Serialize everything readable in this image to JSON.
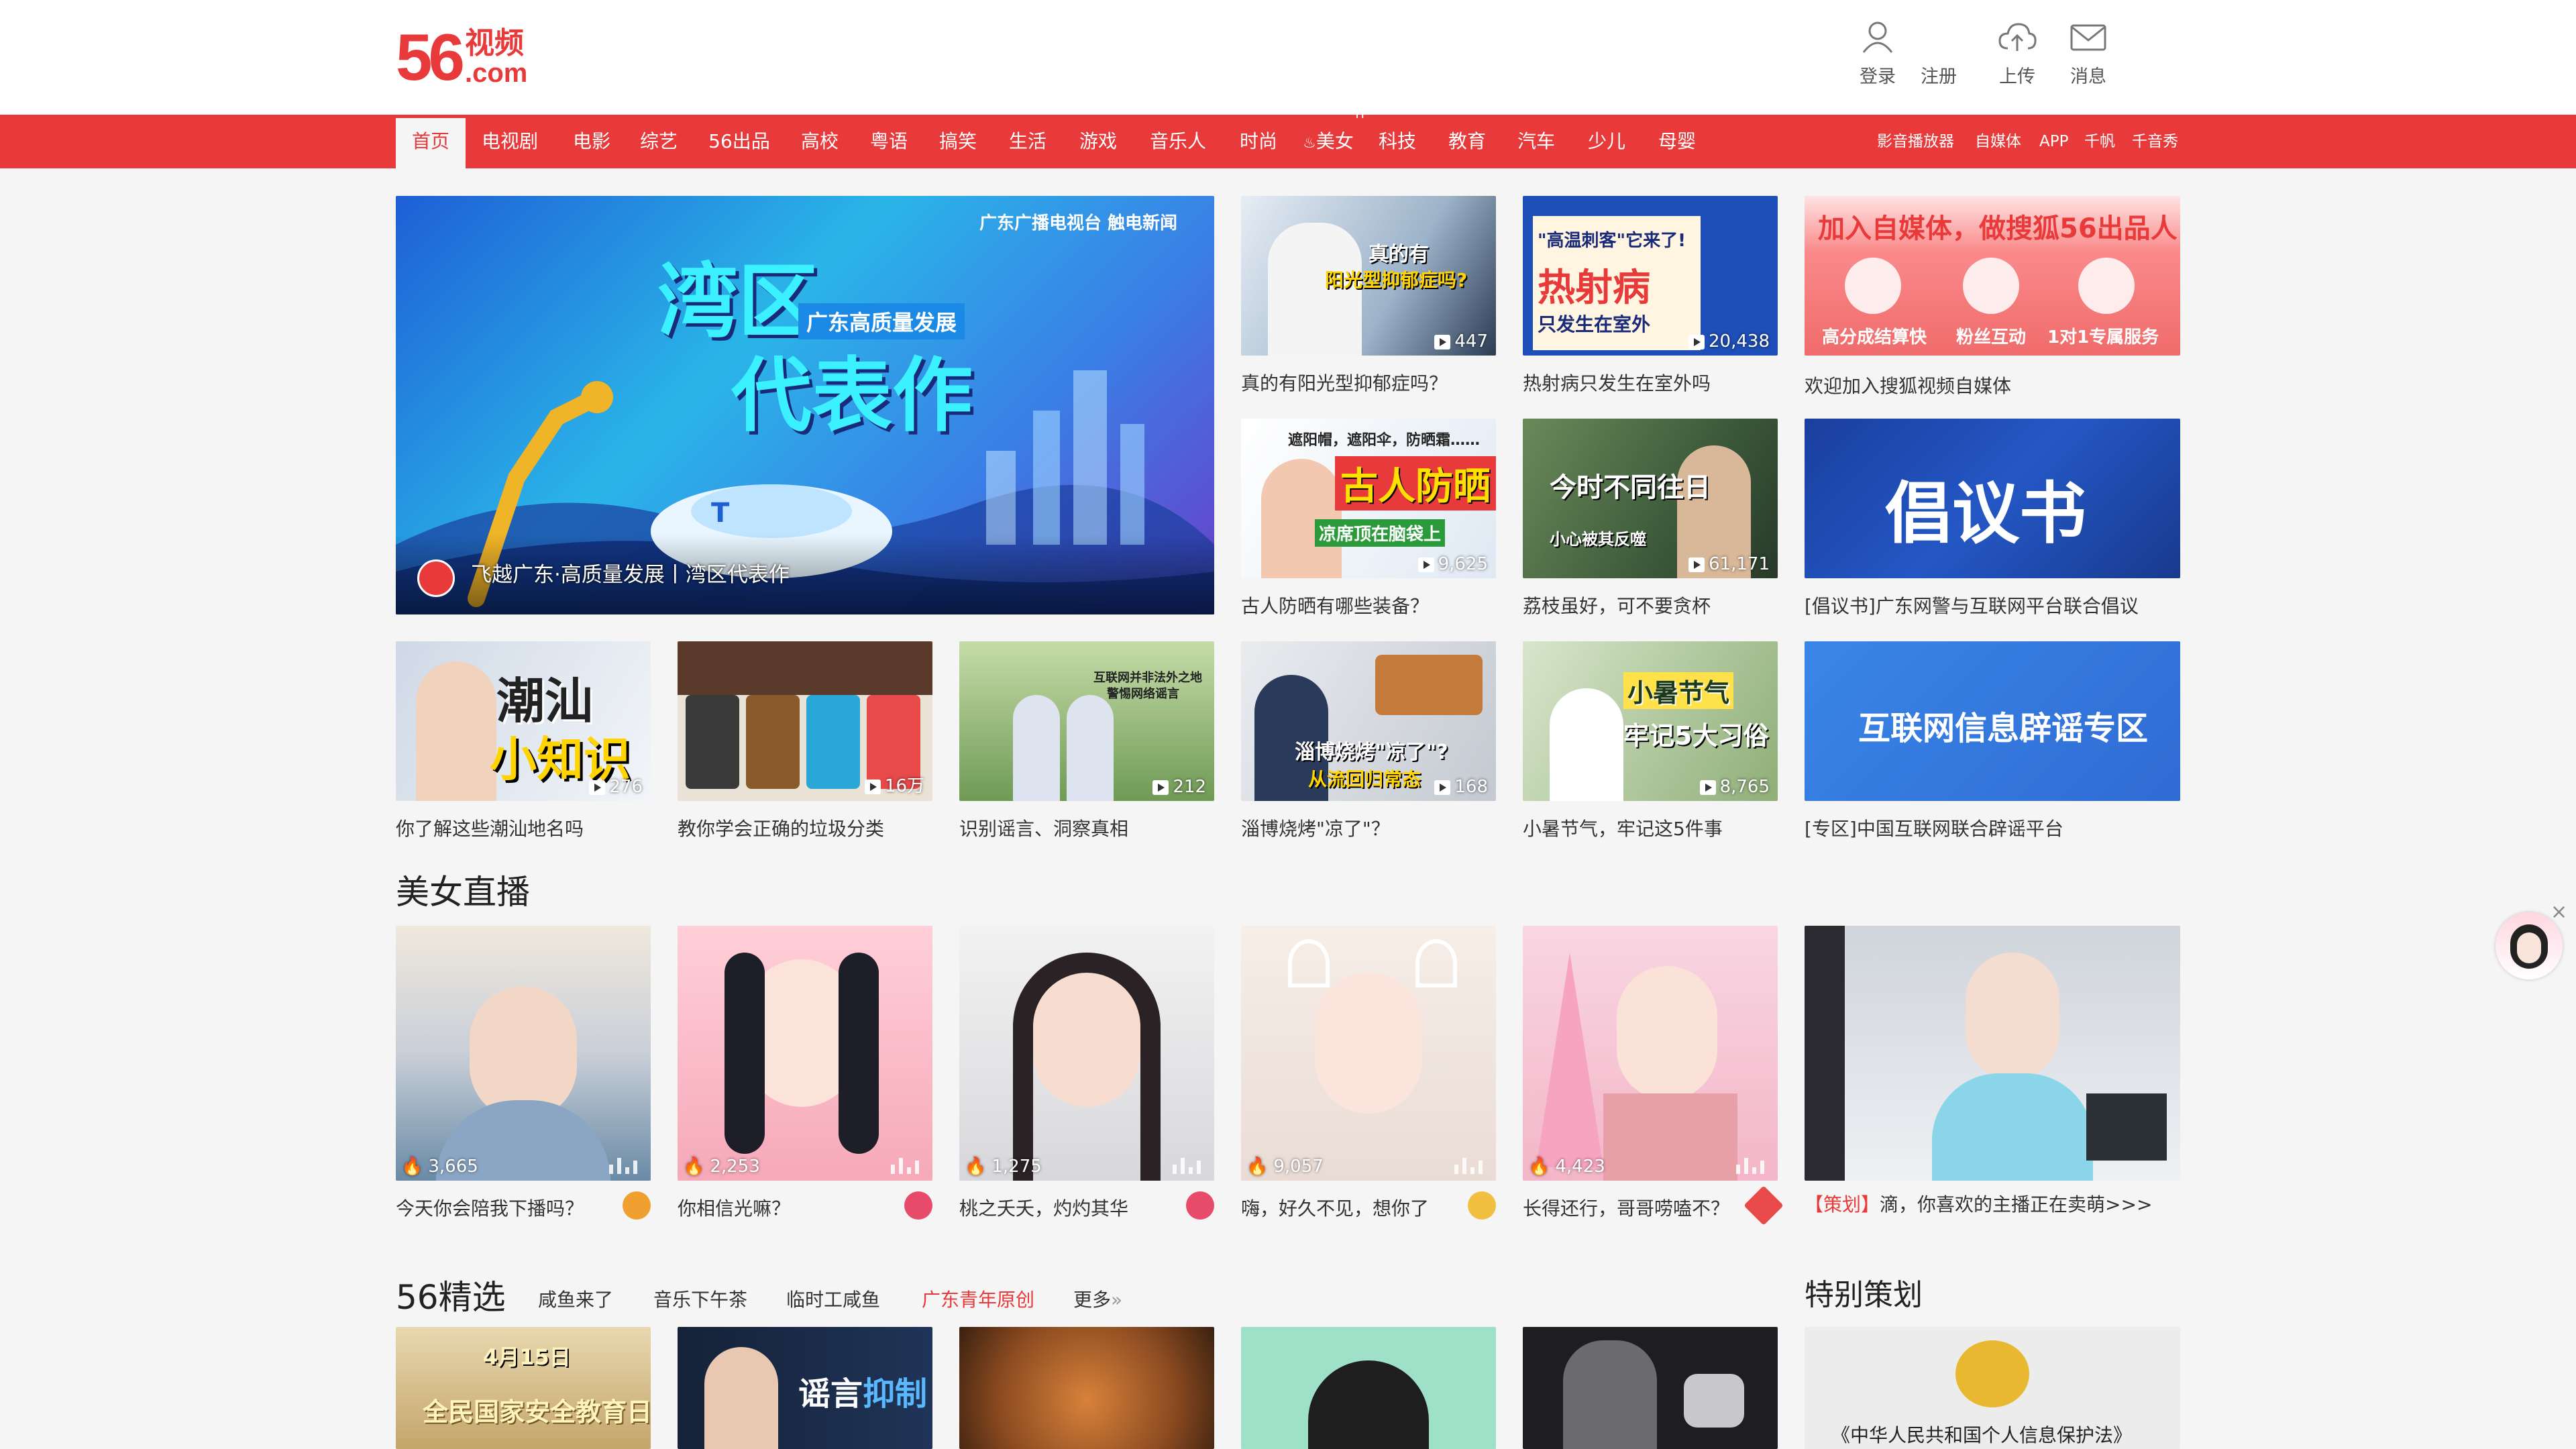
{
  "header": {
    "logo_num": "56",
    "logo_cn": "视频",
    "logo_com": ".com",
    "tools": [
      {
        "label": "登录",
        "icon": "user-icon"
      },
      {
        "label": "注册",
        "icon": ""
      },
      {
        "label": "上传",
        "icon": "upload-cloud-icon"
      },
      {
        "label": "消息",
        "icon": "mail-icon"
      }
    ]
  },
  "nav": {
    "items": [
      "首页",
      "电视剧",
      "电影",
      "综艺",
      "56出品",
      "高校",
      "粤语",
      "搞笑",
      "生活",
      "游戏",
      "音乐人",
      "时尚",
      "美女",
      "科技",
      "教育",
      "汽车",
      "少儿",
      "母婴"
    ],
    "hot_sup": "H",
    "right": [
      "影音播放器",
      "自媒体",
      "APP",
      "千帆",
      "千音秀"
    ]
  },
  "hero": {
    "title_line1": "湾区",
    "title_line2": "代表作",
    "tagline": "广东高质量发展",
    "brands": "广东广播电视台   触电新闻",
    "caption": "飞越广东·高质量发展丨湾区代表作",
    "car_label": "T"
  },
  "grid_top": [
    {
      "overlay1": "真的有",
      "overlay2": "阳光型抑郁症吗?",
      "count": "447",
      "caption": "真的有阳光型抑郁症吗？"
    },
    {
      "overlay1": "\"高温刺客\"它来了!",
      "overlay2": "热射病",
      "overlay3": "只发生在室外",
      "count": "20,438",
      "caption": "热射病只发生在室外吗"
    },
    {
      "overlay1": "遮阳帽，遮阳伞，防晒霜……",
      "overlay2": "古人防晒",
      "overlay3": "凉席顶在脑袋上",
      "count": "9,625",
      "caption": "古人防晒有哪些装备？"
    },
    {
      "overlay1": "今时不同往日",
      "overlay2": "小心被其反噬",
      "count": "61,171",
      "caption": "荔枝虽好，可不要贪杯"
    }
  ],
  "promo": {
    "join_title": "加入自媒体，做搜狐56出品人",
    "join_items": [
      "高分成结算快",
      "粉丝互动",
      "1对1专属服务"
    ],
    "join_caption": "欢迎加入搜狐视频自媒体",
    "proposal_text": "倡议书",
    "proposal_caption": "[倡议书]广东网警与互联网平台联合倡议",
    "rumor_text": "互联网信息辟谣专区",
    "rumor_caption": "[专区]中国互联网联合辟谣平台"
  },
  "grid_row2": [
    {
      "overlay1": "潮汕",
      "overlay2": "小知识",
      "count": "276",
      "caption": "你了解这些潮汕地名吗"
    },
    {
      "overlay1": "",
      "count": "16万",
      "caption": "教你学会正确的垃圾分类"
    },
    {
      "overlay1": "互联网并非法外之地",
      "overlay2": "警惕网络谣言",
      "count": "212",
      "caption": "识别谣言、洞察真相"
    },
    {
      "overlay1": "淄博烧烤\"凉了\"?",
      "overlay2": "从流回归常态",
      "count": "168",
      "caption": "淄博烧烤\"凉了\"？"
    },
    {
      "overlay1": "小暑节气",
      "overlay2": "牢记5大习俗",
      "count": "8,765",
      "caption": "小暑节气，牢记这5件事"
    }
  ],
  "live": {
    "title": "美女直播",
    "items": [
      {
        "count": "3,665",
        "caption": "今天你会陪我下播吗？"
      },
      {
        "count": "2,253",
        "caption": "你相信光嘛？"
      },
      {
        "count": "1,275",
        "caption": "桃之夭夭，灼灼其华"
      },
      {
        "count": "9,057",
        "caption": "嗨，好久不见，想你了"
      },
      {
        "count": "4,423",
        "caption": "长得还行，哥哥唠嗑不？"
      }
    ],
    "promo_tag": "【策划】",
    "promo_caption": "滴，你喜欢的主播正在卖萌>>>"
  },
  "picks": {
    "title": "56精选",
    "tabs": [
      "咸鱼来了",
      "音乐下午茶",
      "临时工咸鱼",
      "广东青年原创",
      "更多"
    ],
    "more_arrow": "»",
    "special_title": "特别策划",
    "thumbs": [
      {
        "overlay1": "4月15日",
        "overlay2": "全民国家安全教育日"
      },
      {
        "overlay1": "谣言",
        "overlay2": "抑制"
      },
      {
        "overlay1": ""
      },
      {
        "overlay1": ""
      },
      {
        "overlay1": ""
      }
    ],
    "special_text": "《中华人民共和国个人信息保护法》"
  },
  "float_close": "×",
  "colors": {
    "brand": "#e83a3a",
    "bg": "#f5f5f5"
  }
}
